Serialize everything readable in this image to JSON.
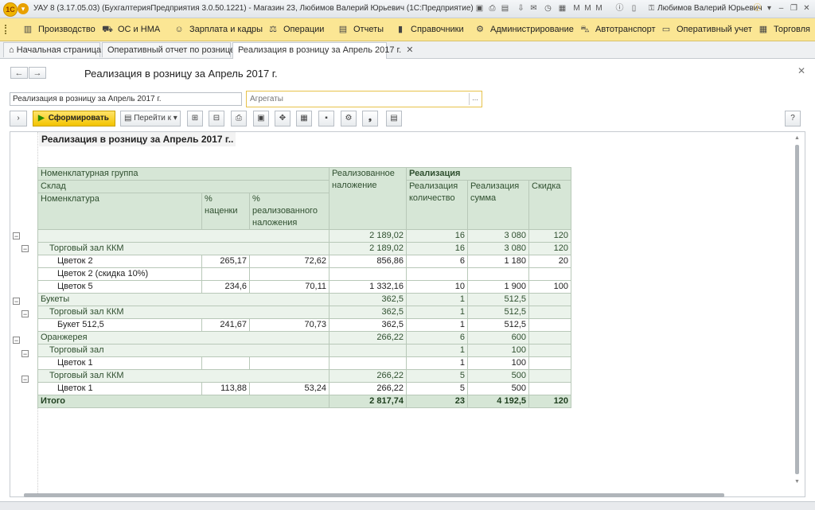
{
  "window": {
    "title": "УАУ 8 (3.17.05.03) (БухгалтерияПредприятия 3.0.50.1221) - Магазин 23, Любимов Валерий Юрьевич  (1С:Предприятие)",
    "user": "Любимов Валерий Юрьевич"
  },
  "sections": [
    {
      "label": "Производство",
      "icon": "factory-icon"
    },
    {
      "label": "ОС и НМА",
      "icon": "truck-icon"
    },
    {
      "label": "Зарплата и кадры",
      "icon": "people-icon"
    },
    {
      "label": "Операции",
      "icon": "operations-icon"
    },
    {
      "label": "Отчеты",
      "icon": "reports-icon"
    },
    {
      "label": "Справочники",
      "icon": "book-icon"
    },
    {
      "label": "Администрирование",
      "icon": "gear-icon"
    },
    {
      "label": "Автотранспорт",
      "icon": "car-icon"
    },
    {
      "label": "Оперативный учет",
      "icon": "monitor-icon"
    },
    {
      "label": "Торговля",
      "icon": "calculator-icon"
    }
  ],
  "tabs": [
    {
      "label": "Начальная страница"
    },
    {
      "label": "Оперативный отчет по рознице *"
    },
    {
      "label": "Реализация в розницу за Апрель 2017 г."
    }
  ],
  "form": {
    "title": "Реализация в розницу за Апрель 2017 г.",
    "variant_value": "Реализация в розницу за Апрель 2017 г.",
    "aggregates_placeholder": "Агрегаты",
    "aggregates_button": "...",
    "generate_label": "Сформировать",
    "goto_label": "Перейти к",
    "help_label": "?"
  },
  "report": {
    "title": "Реализация в розницу за Апрель 2017 г..",
    "headers": {
      "group": "Номенклатурная группа",
      "warehouse": "Склад",
      "item": "Номенклатура",
      "markup_pct": "% наценки",
      "realized_markup_pct": "% реализованного наложения",
      "realized_markup": "Реализованное наложение",
      "sales": "Реализация",
      "sales_qty": "Реализация количество",
      "sales_sum": "Реализация сумма",
      "discount": "Скидка"
    },
    "rows": [
      {
        "level": 0,
        "name": "",
        "markup": "",
        "rmarkup": "",
        "realized": "2 189,02",
        "qty": "16",
        "sum": "3 080",
        "disc": "120"
      },
      {
        "level": 1,
        "name": "Торговый зал ККМ",
        "markup": "",
        "rmarkup": "",
        "realized": "2 189,02",
        "qty": "16",
        "sum": "3 080",
        "disc": "120"
      },
      {
        "level": 2,
        "name": "Цветок 2",
        "markup": "265,17",
        "rmarkup": "72,62",
        "realized": "856,86",
        "qty": "6",
        "sum": "1 180",
        "disc": "20"
      },
      {
        "level": 2,
        "name": "Цветок 2 (скидка 10%)",
        "markup": "",
        "rmarkup": "",
        "realized": "",
        "qty": "",
        "sum": "",
        "disc": ""
      },
      {
        "level": 2,
        "name": "Цветок 5",
        "markup": "234,6",
        "rmarkup": "70,11",
        "realized": "1 332,16",
        "qty": "10",
        "sum": "1 900",
        "disc": "100"
      },
      {
        "level": 0,
        "name": "Букеты",
        "markup": "",
        "rmarkup": "",
        "realized": "362,5",
        "qty": "1",
        "sum": "512,5",
        "disc": ""
      },
      {
        "level": 1,
        "name": "Торговый зал ККМ",
        "markup": "",
        "rmarkup": "",
        "realized": "362,5",
        "qty": "1",
        "sum": "512,5",
        "disc": ""
      },
      {
        "level": 2,
        "name": "Букет 512,5",
        "markup": "241,67",
        "rmarkup": "70,73",
        "realized": "362,5",
        "qty": "1",
        "sum": "512,5",
        "disc": ""
      },
      {
        "level": 0,
        "name": "Оранжерея",
        "markup": "",
        "rmarkup": "",
        "realized": "266,22",
        "qty": "6",
        "sum": "600",
        "disc": ""
      },
      {
        "level": 1,
        "name": "Торговый зал",
        "markup": "",
        "rmarkup": "",
        "realized": "",
        "qty": "1",
        "sum": "100",
        "disc": ""
      },
      {
        "level": 2,
        "name": "Цветок 1",
        "markup": "",
        "rmarkup": "",
        "realized": "",
        "qty": "1",
        "sum": "100",
        "disc": ""
      },
      {
        "level": 1,
        "name": "Торговый зал ККМ",
        "markup": "",
        "rmarkup": "",
        "realized": "266,22",
        "qty": "5",
        "sum": "500",
        "disc": ""
      },
      {
        "level": 2,
        "name": "Цветок 1",
        "markup": "113,88",
        "rmarkup": "53,24",
        "realized": "266,22",
        "qty": "5",
        "sum": "500",
        "disc": ""
      }
    ],
    "total": {
      "name": "Итого",
      "realized": "2 817,74",
      "qty": "23",
      "sum": "4 192,5",
      "disc": "120"
    }
  },
  "colors": {
    "section_bar": "#fbe694",
    "header_fill": "#d6e6d6",
    "group_fill": "#ebf3eb",
    "generate_button": "#f3c400"
  }
}
